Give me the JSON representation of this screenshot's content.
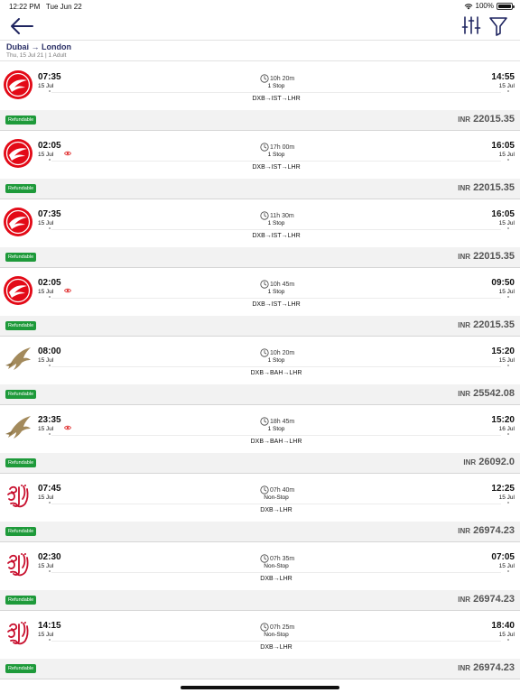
{
  "status_bar": {
    "time": "12:22 PM",
    "date": "Tue Jun 22",
    "battery": "100%"
  },
  "header": {
    "route_title": "Dubai → London",
    "route_sub": "Thu, 15 Jul 21 | 1 Adult"
  },
  "flights": [
    {
      "airline_icon": "turkish-airlines-logo",
      "dep_time": "07:35",
      "dep_date": "15 Jul",
      "viewed": false,
      "duration": "10h 20m",
      "stops": "1 Stop",
      "route": "DXB→IST→LHR",
      "arr_time": "14:55",
      "arr_date": "15 Jul",
      "badge": "Refundable",
      "currency": "INR",
      "price": "22015.35"
    },
    {
      "airline_icon": "turkish-airlines-logo",
      "dep_time": "02:05",
      "dep_date": "15 Jul",
      "viewed": true,
      "duration": "17h 00m",
      "stops": "1 Stop",
      "route": "DXB→IST→LHR",
      "arr_time": "16:05",
      "arr_date": "15 Jul",
      "badge": "Refundable",
      "currency": "INR",
      "price": "22015.35"
    },
    {
      "airline_icon": "turkish-airlines-logo",
      "dep_time": "07:35",
      "dep_date": "15 Jul",
      "viewed": false,
      "duration": "11h 30m",
      "stops": "1 Stop",
      "route": "DXB→IST→LHR",
      "arr_time": "16:05",
      "arr_date": "15 Jul",
      "badge": "Refundable",
      "currency": "INR",
      "price": "22015.35"
    },
    {
      "airline_icon": "turkish-airlines-logo",
      "dep_time": "02:05",
      "dep_date": "15 Jul",
      "viewed": true,
      "duration": "10h 45m",
      "stops": "1 Stop",
      "route": "DXB→IST→LHR",
      "arr_time": "09:50",
      "arr_date": "15 Jul",
      "badge": "Refundable",
      "currency": "INR",
      "price": "22015.35"
    },
    {
      "airline_icon": "gulf-air-logo",
      "dep_time": "08:00",
      "dep_date": "15 Jul",
      "viewed": false,
      "duration": "10h 20m",
      "stops": "1 Stop",
      "route": "DXB→BAH→LHR",
      "arr_time": "15:20",
      "arr_date": "15 Jul",
      "badge": "Refundable",
      "currency": "INR",
      "price": "25542.08"
    },
    {
      "airline_icon": "gulf-air-logo",
      "dep_time": "23:35",
      "dep_date": "15 Jul",
      "viewed": true,
      "duration": "18h 45m",
      "stops": "1 Stop",
      "route": "DXB→BAH→LHR",
      "arr_time": "15:20",
      "arr_date": "16 Jul",
      "badge": "Refundable",
      "currency": "INR",
      "price": "26092.0"
    },
    {
      "airline_icon": "emirates-logo",
      "dep_time": "07:45",
      "dep_date": "15 Jul",
      "viewed": false,
      "duration": "07h 40m",
      "stops": "Non-Stop",
      "route": "DXB→LHR",
      "arr_time": "12:25",
      "arr_date": "15 Jul",
      "badge": "Refundable",
      "currency": "INR",
      "price": "26974.23"
    },
    {
      "airline_icon": "emirates-logo",
      "dep_time": "02:30",
      "dep_date": "15 Jul",
      "viewed": false,
      "duration": "07h 35m",
      "stops": "Non-Stop",
      "route": "DXB→LHR",
      "arr_time": "07:05",
      "arr_date": "15 Jul",
      "badge": "Refundable",
      "currency": "INR",
      "price": "26974.23"
    },
    {
      "airline_icon": "emirates-logo",
      "dep_time": "14:15",
      "dep_date": "15 Jul",
      "viewed": false,
      "duration": "07h 25m",
      "stops": "Non-Stop",
      "route": "DXB→LHR",
      "arr_time": "18:40",
      "arr_date": "15 Jul",
      "badge": "Refundable",
      "currency": "INR",
      "price": "26974.23"
    }
  ],
  "colors": {
    "brand_navy": "#2a2f66",
    "refundable_green": "#1e9a3a",
    "turkish_red": "#e30a17",
    "gulf_gold": "#a38a5c",
    "emirates_red": "#c8102e"
  }
}
